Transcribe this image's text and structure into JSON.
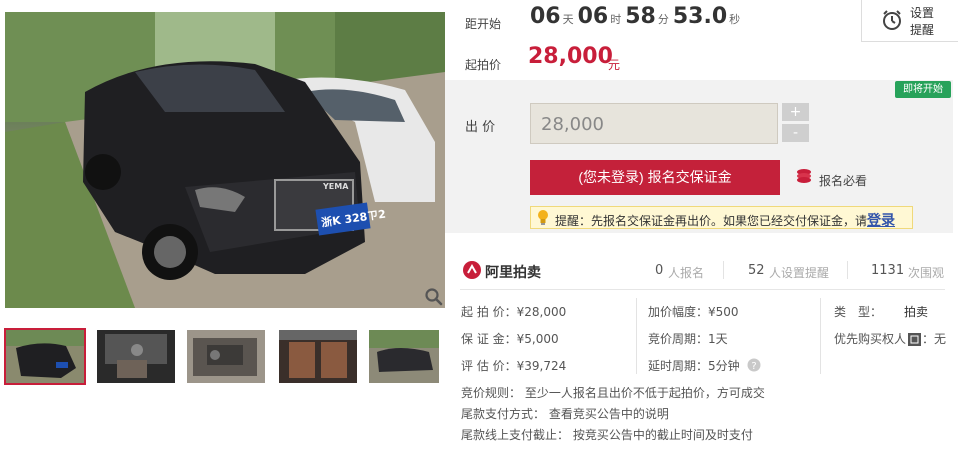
{
  "countdown": {
    "label": "距开始",
    "days": "06",
    "days_unit": "天",
    "hours": "06",
    "hours_unit": "时",
    "minutes": "58",
    "minutes_unit": "分",
    "seconds": "53.0",
    "seconds_unit": "秒"
  },
  "remind": {
    "line1": "设置",
    "line2": "提醒"
  },
  "start_price": {
    "label": "起拍价",
    "value": "28,000",
    "unit": "元"
  },
  "badge": "即将开始",
  "bid": {
    "label": "出 价",
    "value": "28,000",
    "plus": "+",
    "minus": "-"
  },
  "register_button": "(您未登录) 报名交保证金",
  "must_read": "报名必看",
  "notice": {
    "text": "提醒：先报名交保证金再出价。如果您已经交付保证金，请",
    "link": "登录"
  },
  "brand": "阿里拍卖",
  "stats": [
    {
      "num": "0",
      "text": "人报名"
    },
    {
      "num": "52",
      "text": "人设置提醒"
    },
    {
      "num": "1131",
      "text": "次围观"
    }
  ],
  "details": {
    "start_price": "起 拍 价：¥28,000",
    "deposit": "保 证 金：¥5,000",
    "estimate": "评 估 价：¥39,724",
    "increment": "加价幅度：¥500",
    "cycle": "竞价周期：1天",
    "delay": "延时周期：5分钟",
    "type_label": "类　型：",
    "type_value": "拍卖",
    "priority_label": "优先购买权人",
    "priority_value": "：无"
  },
  "rules": {
    "rule": "竞价规则：  至少一人报名且出价不低于起拍价，方可成交",
    "payment": "尾款支付方式：  查看竞买公告中的说明",
    "deadline": "尾款线上支付截止：  按竞买公告中的截止时间及时支付"
  },
  "plate": "浙K 328ㄗ2",
  "car_logo": "YEMA",
  "colors": {
    "accent": "#c81e3a",
    "badge": "#27a25a"
  }
}
